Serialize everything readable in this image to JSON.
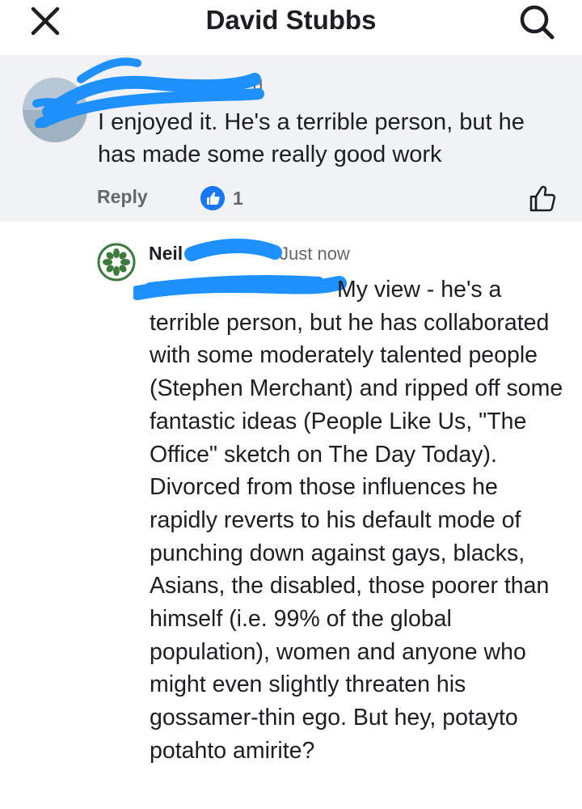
{
  "header": {
    "title": "David Stubbs",
    "close_icon": "close-icon",
    "search_icon": "search-icon"
  },
  "parent_comment": {
    "author_suffix": "d",
    "text": "I enjoyed it.  He's a terrible person, but he has made some really good work",
    "reply_label": "Reply",
    "like_count": "1"
  },
  "reply_comment": {
    "author": "Neil",
    "timestamp": "Just now",
    "text": "My view - he's a terrible person, but he has collaborated with some moderately talented people (Stephen Merchant) and ripped off some fantastic ideas (People Like Us, \"The Office\" sketch on The Day Today). Divorced from those influences he rapidly reverts to his default mode of punching down against gays, blacks, Asians, the disabled, those poorer than himself (i.e. 99% of the global population), women and anyone who might even slightly threaten his gossamer-thin ego. But hey, potayto potahto amirite?"
  },
  "colors": {
    "accent": "#1877f2",
    "redaction": "#1e90ff",
    "muted_text": "#65676b",
    "parent_bg": "#f0f2f5"
  }
}
